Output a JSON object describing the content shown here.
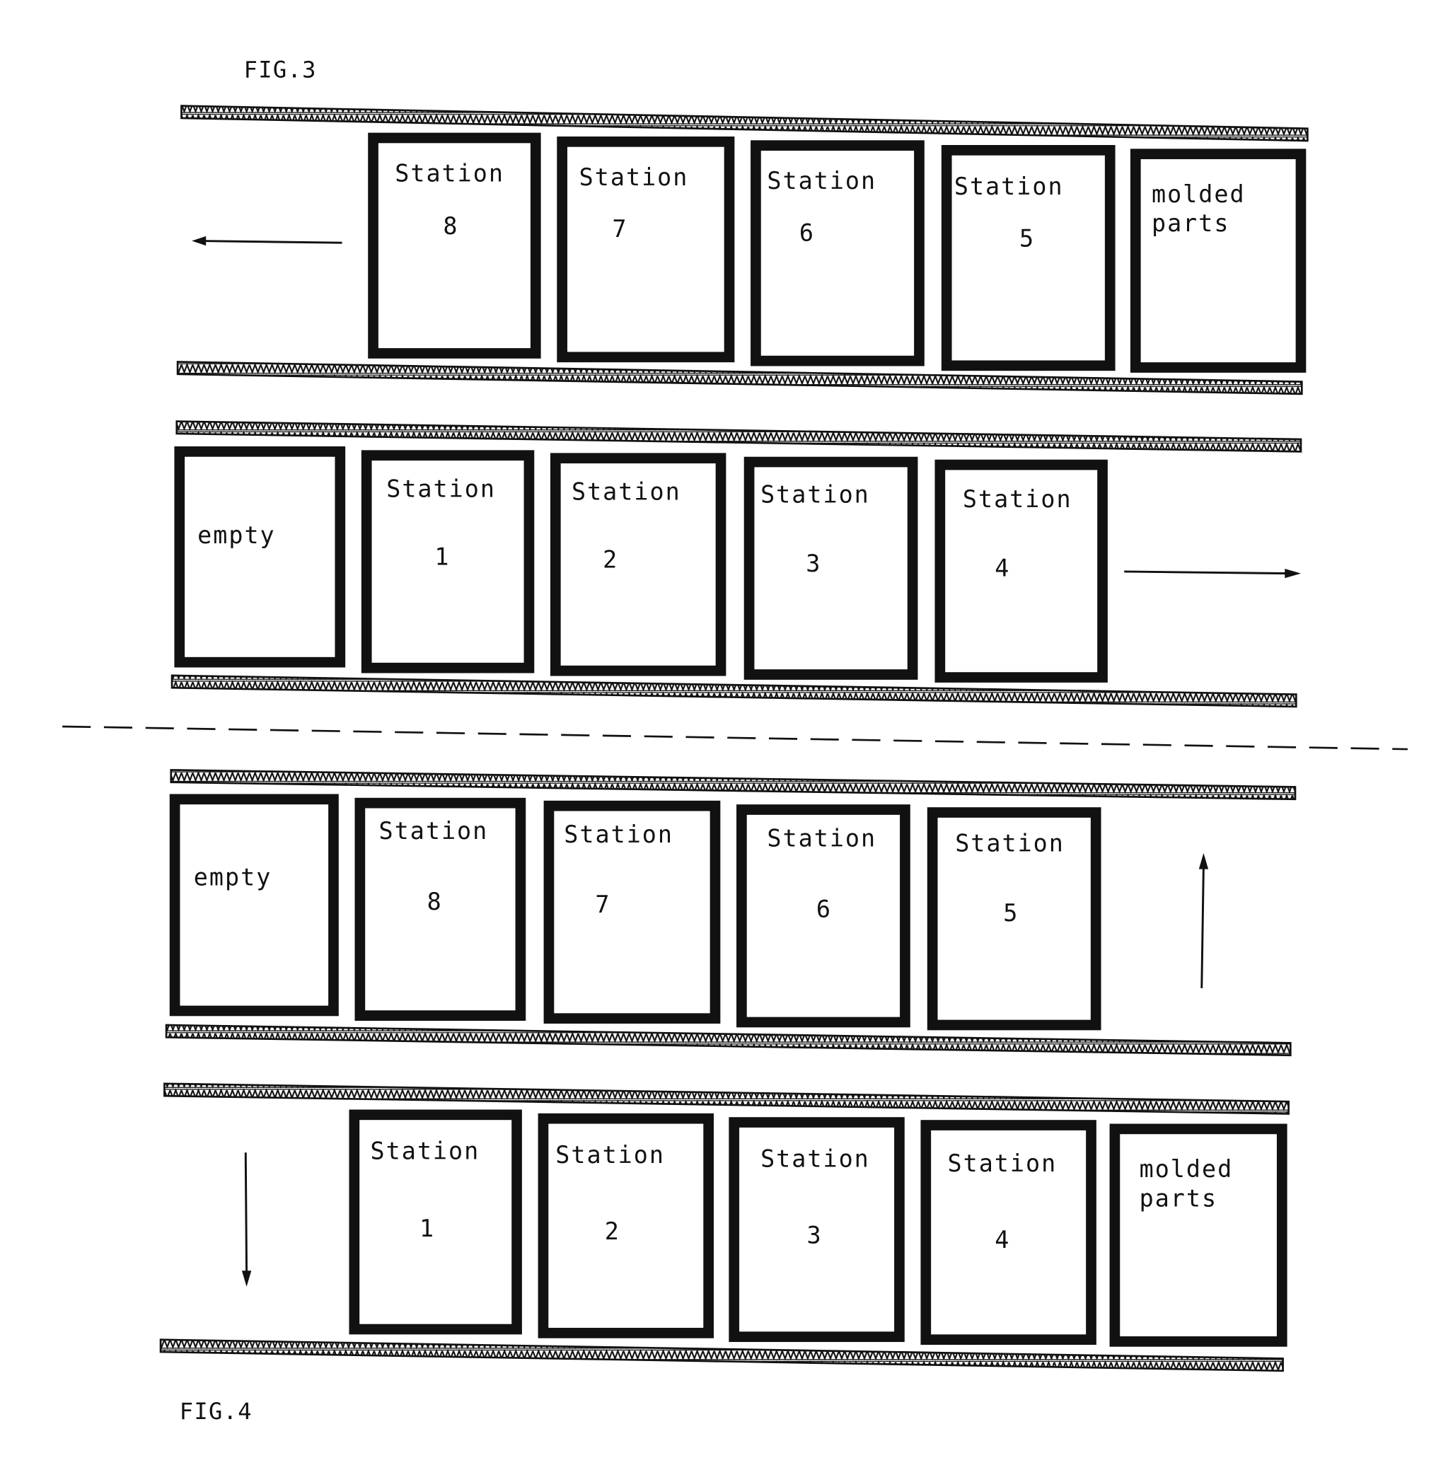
{
  "figures": [
    {
      "caption": "FIG.3",
      "rows": [
        {
          "direction": "left",
          "stations": [
            {
              "line1": "Station",
              "line2": "8"
            },
            {
              "line1": "Station",
              "line2": "7"
            },
            {
              "line1": "Station",
              "line2": "6"
            },
            {
              "line1": "Station",
              "line2": "5"
            },
            {
              "line1": "molded",
              "line2": "parts"
            }
          ]
        },
        {
          "direction": "right",
          "stations": [
            {
              "line1": "empty",
              "line2": ""
            },
            {
              "line1": "Station",
              "line2": "1"
            },
            {
              "line1": "Station",
              "line2": "2"
            },
            {
              "line1": "Station",
              "line2": "3"
            },
            {
              "line1": "Station",
              "line2": "4"
            }
          ]
        }
      ]
    },
    {
      "caption": "FIG.4",
      "rows": [
        {
          "direction": "up",
          "stations": [
            {
              "line1": "empty",
              "line2": ""
            },
            {
              "line1": "Station",
              "line2": "8"
            },
            {
              "line1": "Station",
              "line2": "7"
            },
            {
              "line1": "Station",
              "line2": "6"
            },
            {
              "line1": "Station",
              "line2": "5"
            }
          ]
        },
        {
          "direction": "down",
          "stations": [
            {
              "line1": "Station",
              "line2": "1"
            },
            {
              "line1": "Station",
              "line2": "2"
            },
            {
              "line1": "Station",
              "line2": "3"
            },
            {
              "line1": "Station",
              "line2": "4"
            },
            {
              "line1": "molded",
              "line2": "parts"
            }
          ]
        }
      ]
    }
  ]
}
